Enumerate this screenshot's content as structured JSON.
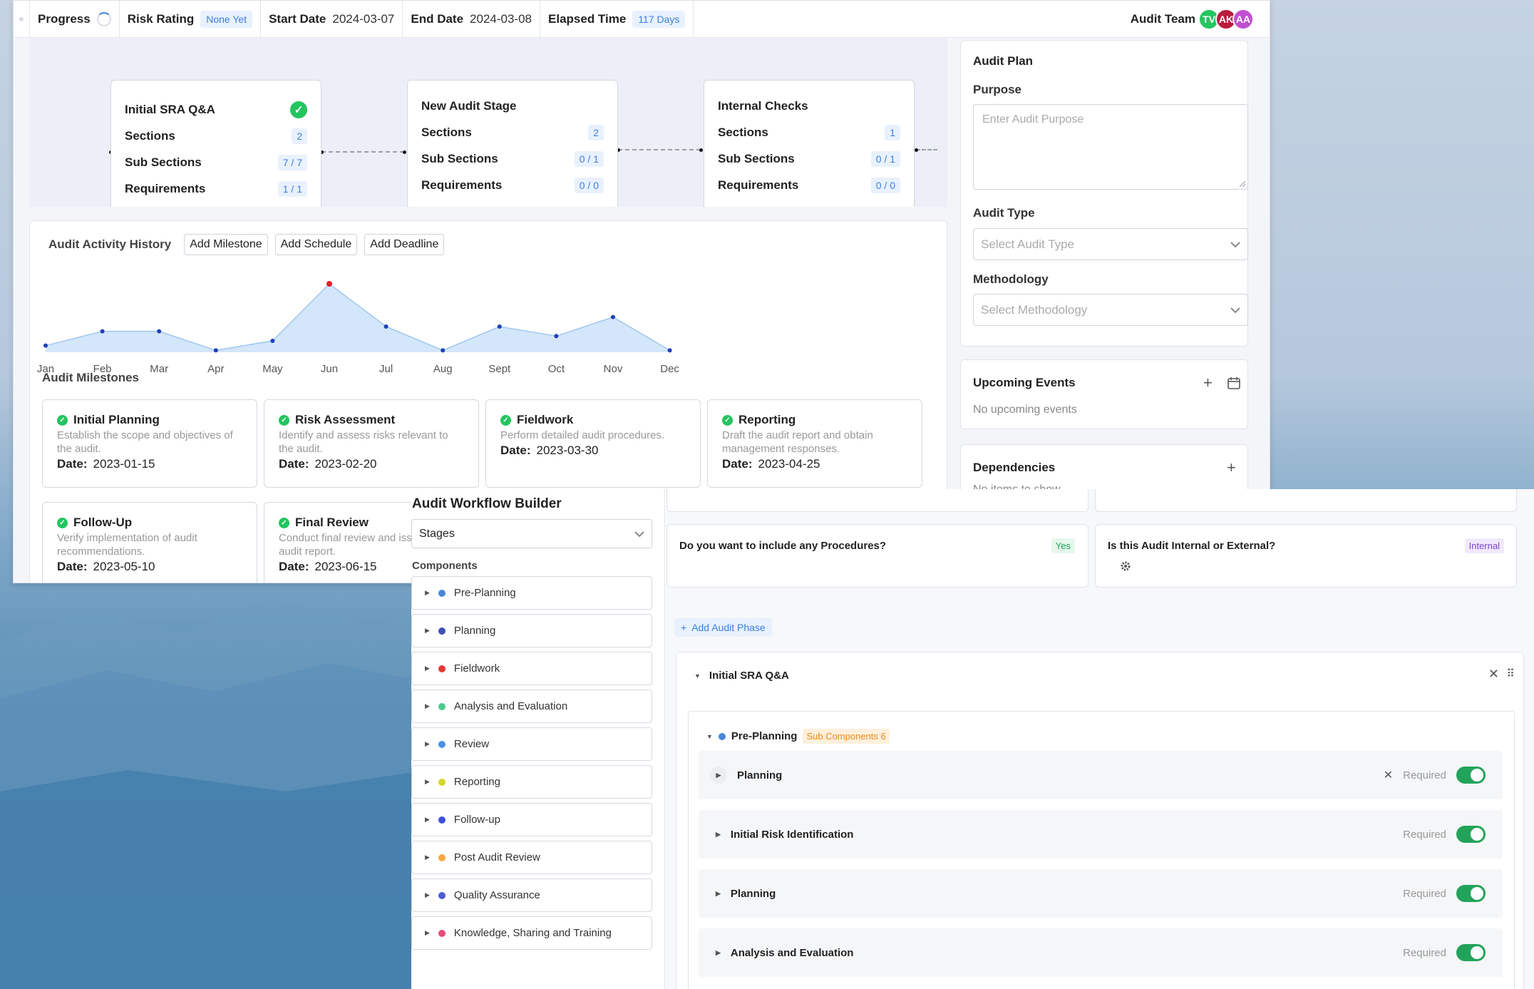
{
  "topbar": {
    "progress_label": "Progress",
    "risk_label": "Risk Rating",
    "risk_value": "None Yet",
    "start_label": "Start Date",
    "start_value": "2024-03-07",
    "end_label": "End Date",
    "end_value": "2024-03-08",
    "elapsed_label": "Elapsed Time",
    "elapsed_value": "117 Days",
    "team_label": "Audit Team",
    "avatars": [
      {
        "initials": "TV",
        "color": "#22c55e"
      },
      {
        "initials": "AK",
        "color": "#b91c3c"
      },
      {
        "initials": "AA",
        "color": "#c14fd1"
      }
    ]
  },
  "stages": [
    {
      "title": "Initial SRA Q&A",
      "completed": true,
      "sections_label": "Sections",
      "sections": "2",
      "sub_label": "Sub Sections",
      "sub": "7 / 7",
      "req_label": "Requirements",
      "req": "1 / 1"
    },
    {
      "title": "New Audit Stage",
      "completed": false,
      "sections_label": "Sections",
      "sections": "2",
      "sub_label": "Sub Sections",
      "sub": "0 / 1",
      "req_label": "Requirements",
      "req": "0 / 0"
    },
    {
      "title": "Internal Checks",
      "completed": false,
      "sections_label": "Sections",
      "sections": "1",
      "sub_label": "Sub Sections",
      "sub": "0 / 1",
      "req_label": "Requirements",
      "req": "0 / 0"
    }
  ],
  "activity": {
    "title": "Audit Activity History",
    "buttons": [
      "Add Milestone",
      "Add Schedule",
      "Add Deadline"
    ]
  },
  "chart_data": {
    "type": "area",
    "categories": [
      "Jan",
      "Feb",
      "Mar",
      "Apr",
      "May",
      "Jun",
      "Jul",
      "Aug",
      "Sept",
      "Oct",
      "Nov",
      "Dec"
    ],
    "values": [
      2,
      5,
      5,
      1,
      3,
      15,
      6,
      1,
      6,
      4,
      8,
      1
    ],
    "highlight_index": 5,
    "line_color": "#9fc7ef",
    "fill_color": "#d4e6fa",
    "point_color": "#1e3fb8",
    "highlight_color": "#e11d2a"
  },
  "milestones_title": "Audit Milestones",
  "milestones": [
    {
      "title": "Initial Planning",
      "desc": "Establish the scope and objectives of the audit.",
      "date_label": "Date:",
      "date": "2023-01-15"
    },
    {
      "title": "Risk Assessment",
      "desc": "Identify and assess risks relevant to the audit.",
      "date_label": "Date:",
      "date": "2023-02-20"
    },
    {
      "title": "Fieldwork",
      "desc": "Perform detailed audit procedures.",
      "date_label": "Date:",
      "date": "2023-03-30"
    },
    {
      "title": "Reporting",
      "desc": "Draft the audit report and obtain management responses.",
      "date_label": "Date:",
      "date": "2023-04-25"
    },
    {
      "title": "Follow-Up",
      "desc": "Verify implementation of audit recommendations.",
      "date_label": "Date:",
      "date": "2023-05-10"
    },
    {
      "title": "Final Review",
      "desc": "Conduct final review and issue the audit report.",
      "date_label": "Date:",
      "date": "2023-06-15"
    }
  ],
  "plan": {
    "title": "Audit Plan",
    "purpose_label": "Purpose",
    "purpose_placeholder": "Enter Audit Purpose",
    "type_label": "Audit Type",
    "type_placeholder": "Select Audit Type",
    "method_label": "Methodology",
    "method_placeholder": "Select Methodology",
    "events_title": "Upcoming Events",
    "events_empty": "No upcoming events",
    "deps_title": "Dependencies",
    "deps_empty": "No items to show"
  },
  "builder": {
    "title": "Audit Workflow Builder",
    "select_value": "Stages",
    "components_label": "Components",
    "components": [
      {
        "label": "Pre-Planning",
        "color": "#4a86d8"
      },
      {
        "label": "Planning",
        "color": "#3f51b5"
      },
      {
        "label": "Fieldwork",
        "color": "#e53935"
      },
      {
        "label": "Analysis and Evaluation",
        "color": "#4cc98a"
      },
      {
        "label": "Review",
        "color": "#4a90e2"
      },
      {
        "label": "Reporting",
        "color": "#d4d42a"
      },
      {
        "label": "Follow-up",
        "color": "#3f51d8"
      },
      {
        "label": "Post Audit Review",
        "color": "#f5a742"
      },
      {
        "label": "Quality Assurance",
        "color": "#4f5bd5"
      },
      {
        "label": "Knowledge, Sharing and Training",
        "color": "#e84b77"
      }
    ]
  },
  "questions": [
    {
      "text": "Do you want to include any Procedures?",
      "answer": "Yes"
    },
    {
      "text": "Is this Audit Internal or External?",
      "answer": "Internal"
    }
  ],
  "add_phase_label": "Add Audit Phase",
  "phase": {
    "title": "Initial SRA Q&A",
    "group_title": "Pre-Planning",
    "group_badge": "Sub Components 6",
    "required_label": "Required",
    "subs": [
      "Planning",
      "Initial Risk Identification",
      "Planning",
      "Analysis and Evaluation"
    ]
  }
}
